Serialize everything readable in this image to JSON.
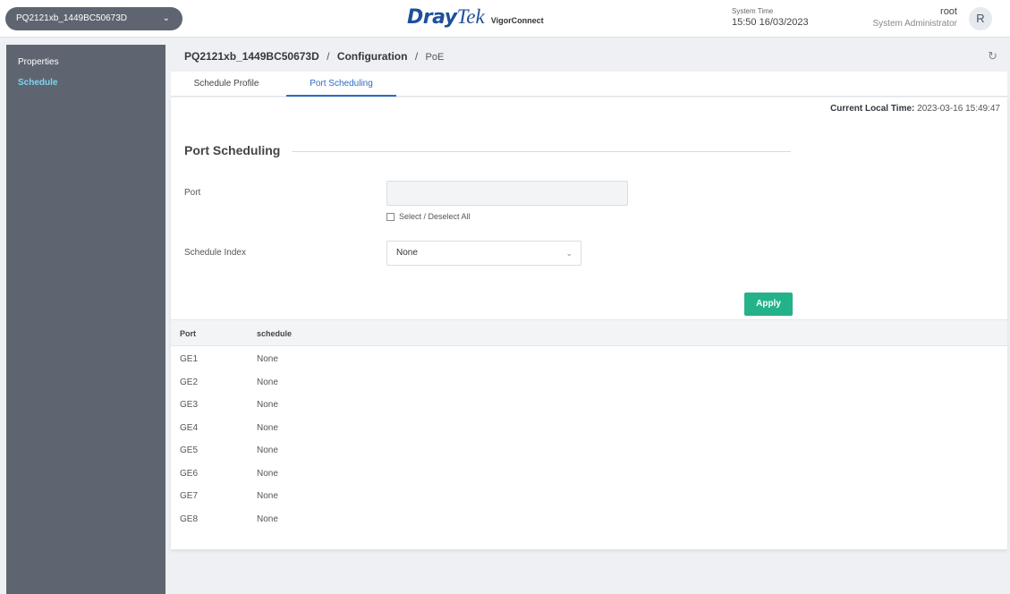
{
  "header": {
    "device_selector": "PQ2121xb_1449BC50673D",
    "logo_dray": "Dray",
    "logo_tek": "Tek",
    "logo_sub": "VigorConnect",
    "system_time_label": "System Time",
    "system_time_value": "15:50 16/03/2023",
    "user_name": "root",
    "user_role": "System Administrator",
    "avatar_letter": "R"
  },
  "sidebar": {
    "items": [
      {
        "label": "Properties"
      },
      {
        "label": "Schedule"
      }
    ]
  },
  "breadcrumb": {
    "device": "PQ2121xb_1449BC50673D",
    "sep1": "/",
    "section": "Configuration",
    "sep2": "/",
    "page": "PoE"
  },
  "tabs": [
    {
      "label": "Schedule Profile"
    },
    {
      "label": "Port Scheduling"
    }
  ],
  "panel": {
    "local_time_label": "Current Local Time:",
    "local_time_value": "2023-03-16 15:49:47",
    "section_title": "Port Scheduling",
    "port_label": "Port",
    "port_value": "",
    "select_all_label": "Select / Deselect All",
    "schedule_index_label": "Schedule Index",
    "schedule_index_value": "None",
    "apply_label": "Apply"
  },
  "table": {
    "columns": [
      "Port",
      "schedule"
    ],
    "rows": [
      {
        "port": "GE1",
        "schedule": "None"
      },
      {
        "port": "GE2",
        "schedule": "None"
      },
      {
        "port": "GE3",
        "schedule": "None"
      },
      {
        "port": "GE4",
        "schedule": "None"
      },
      {
        "port": "GE5",
        "schedule": "None"
      },
      {
        "port": "GE6",
        "schedule": "None"
      },
      {
        "port": "GE7",
        "schedule": "None"
      },
      {
        "port": "GE8",
        "schedule": "None"
      }
    ]
  },
  "colors": {
    "sidebar_bg": "#5e6571",
    "active_sidebar_text": "#7dd4f2",
    "active_tab": "#2c6cc0",
    "apply_button": "#24b28a",
    "brand": "#1e4f9c"
  }
}
